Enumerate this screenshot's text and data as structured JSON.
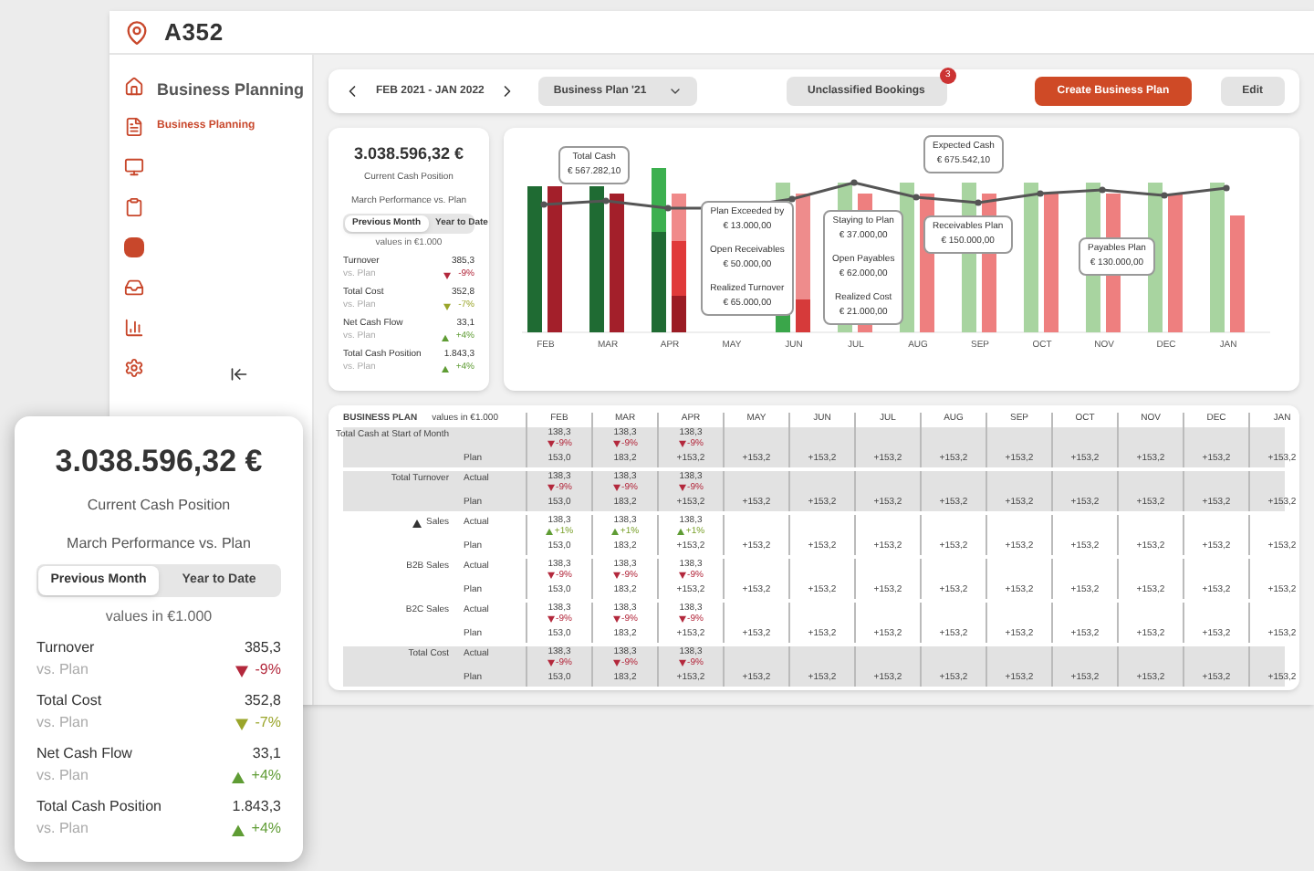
{
  "app": {
    "logo": "A352"
  },
  "sidebar": {
    "title": "Business Planning",
    "items": [
      {
        "label": "Business Planning",
        "selected": true
      }
    ]
  },
  "toolbar": {
    "period": "FEB 2021 - JAN 2022",
    "plan_select": "Business Plan '21",
    "unclassified": {
      "label": "Unclassified Bookings",
      "badge": "3"
    },
    "create": "Create Business Plan",
    "edit": "Edit"
  },
  "summary_card": {
    "amount": "3.038.596,32 €",
    "caption": "Current Cash Position",
    "subtitle": "March Performance vs. Plan",
    "toggle": [
      {
        "label": "Previous Month",
        "selected": true
      },
      {
        "label": "Year to Date",
        "selected": false
      }
    ],
    "unit": "values in €1.000",
    "metrics": [
      {
        "name": "Turnover",
        "value": "385,3",
        "sub": "vs. Plan",
        "delta": "-9%",
        "kind": "down",
        "color": "#b3283c"
      },
      {
        "name": "Total Cost",
        "value": "352,8",
        "sub": "vs. Plan",
        "delta": "-7%",
        "kind": "down",
        "color": "#9aa52a"
      },
      {
        "name": "Net Cash Flow",
        "value": "33,1",
        "sub": "vs. Plan",
        "delta": "+4%",
        "kind": "up",
        "color": "#5f9c34"
      },
      {
        "name": "Total Cash Position",
        "value": "1.843,3",
        "sub": "vs. Plan",
        "delta": "+4%",
        "kind": "up",
        "color": "#5f9c34"
      }
    ]
  },
  "chart": {
    "months": [
      "FEB",
      "MAR",
      "APR",
      "MAY",
      "JUN",
      "JUL",
      "AUG",
      "SEP",
      "OCT",
      "NOV",
      "DEC",
      "JAN"
    ],
    "callouts": [
      {
        "items": [
          {
            "label": "Total Cash",
            "amount": "€ 567.282,10"
          }
        ]
      },
      {
        "items": [
          {
            "label": "Plan Exceeded by",
            "amount": "€ 13.000,00"
          },
          {
            "label": "Open Receivables",
            "amount": "€ 50.000,00"
          },
          {
            "label": "Realized Turnover",
            "amount": "€ 65.000,00"
          }
        ]
      },
      {
        "items": [
          {
            "label": "Staying to Plan",
            "amount": "€ 37.000,00"
          },
          {
            "label": "Open Payables",
            "amount": "€ 62.000,00"
          },
          {
            "label": "Realized Cost",
            "amount": "€ 21.000,00"
          }
        ]
      },
      {
        "items": [
          {
            "label": "Expected Cash",
            "amount": "€ 675.542,10"
          }
        ]
      },
      {
        "items": [
          {
            "label": "Receivables Plan",
            "amount": "€ 150.000,00"
          }
        ]
      },
      {
        "items": [
          {
            "label": "Payables Plan",
            "amount": "€ 130.000,00"
          }
        ]
      }
    ]
  },
  "table": {
    "title": "BUSINESS PLAN",
    "unit": "values in €1.000",
    "columns": [
      "FEB",
      "MAR",
      "APR",
      "MAY",
      "JUN",
      "JUL",
      "AUG",
      "SEP",
      "OCT",
      "NOV",
      "DEC",
      "JAN"
    ],
    "groups": [
      {
        "label": "Total Cash at Start of Month",
        "shaded": true,
        "actual": [
          {
            "value": "138,3",
            "delta": "-9%",
            "kind": "down"
          },
          {
            "value": "138,3",
            "delta": "-9%",
            "kind": "down"
          },
          {
            "value": "138,3",
            "delta": "-9%",
            "kind": "down"
          }
        ],
        "plan_label": "Plan",
        "plan": [
          "153,0",
          "183,2",
          "+153,2",
          "+153,2",
          "+153,2",
          "+153,2",
          "+153,2",
          "+153,2",
          "+153,2",
          "+153,2",
          "+153,2",
          "+153,2"
        ]
      },
      {
        "label": "Total Turnover",
        "actual_label": "Actual",
        "shaded": true,
        "actual": [
          {
            "value": "138,3",
            "delta": "-9%",
            "kind": "down"
          },
          {
            "value": "138,3",
            "delta": "-9%",
            "kind": "down"
          },
          {
            "value": "138,3",
            "delta": "-9%",
            "kind": "down"
          }
        ],
        "plan_label": "Plan",
        "plan": [
          "153,0",
          "183,2",
          "+153,2",
          "+153,2",
          "+153,2",
          "+153,2",
          "+153,2",
          "+153,2",
          "+153,2",
          "+153,2",
          "+153,2",
          "+153,2"
        ]
      },
      {
        "label": "Sales",
        "expanded": true,
        "actual_label": "Actual",
        "shaded": false,
        "actual": [
          {
            "value": "138,3",
            "delta": "+1%",
            "kind": "up"
          },
          {
            "value": "138,3",
            "delta": "+1%",
            "kind": "up"
          },
          {
            "value": "138,3",
            "delta": "+1%",
            "kind": "up"
          }
        ],
        "plan_label": "Plan",
        "plan": [
          "153,0",
          "183,2",
          "+153,2",
          "+153,2",
          "+153,2",
          "+153,2",
          "+153,2",
          "+153,2",
          "+153,2",
          "+153,2",
          "+153,2",
          "+153,2"
        ]
      },
      {
        "label": "B2B Sales",
        "actual_label": "Actual",
        "shaded": false,
        "actual": [
          {
            "value": "138,3",
            "delta": "-9%",
            "kind": "down"
          },
          {
            "value": "138,3",
            "delta": "-9%",
            "kind": "down"
          },
          {
            "value": "138,3",
            "delta": "-9%",
            "kind": "down"
          }
        ],
        "plan_label": "Plan",
        "plan": [
          "153,0",
          "183,2",
          "+153,2",
          "+153,2",
          "+153,2",
          "+153,2",
          "+153,2",
          "+153,2",
          "+153,2",
          "+153,2",
          "+153,2",
          "+153,2"
        ]
      },
      {
        "label": "B2C Sales",
        "actual_label": "Actual",
        "shaded": false,
        "actual": [
          {
            "value": "138,3",
            "delta": "-9%",
            "kind": "down"
          },
          {
            "value": "138,3",
            "delta": "-9%",
            "kind": "down"
          },
          {
            "value": "138,3",
            "delta": "-9%",
            "kind": "down"
          }
        ],
        "plan_label": "Plan",
        "plan": [
          "153,0",
          "183,2",
          "+153,2",
          "+153,2",
          "+153,2",
          "+153,2",
          "+153,2",
          "+153,2",
          "+153,2",
          "+153,2",
          "+153,2",
          "+153,2"
        ]
      },
      {
        "label": "Total Cost",
        "actual_label": "Actual",
        "shaded": true,
        "actual": [
          {
            "value": "138,3",
            "delta": "-9%",
            "kind": "down"
          },
          {
            "value": "138,3",
            "delta": "-9%",
            "kind": "down"
          },
          {
            "value": "138,3",
            "delta": "-9%",
            "kind": "down"
          }
        ],
        "plan_label": "Plan",
        "plan": [
          "153,0",
          "183,2",
          "+153,2",
          "+153,2",
          "+153,2",
          "+153,2",
          "+153,2",
          "+153,2",
          "+153,2",
          "+153,2",
          "+153,2",
          "+153,2"
        ]
      }
    ]
  },
  "popup_card": {
    "amount": "3.038.596,32 €",
    "caption": "Current Cash Position",
    "subtitle": "March Performance vs. Plan",
    "toggle": [
      {
        "label": "Previous Month",
        "selected": true
      },
      {
        "label": "Year to Date",
        "selected": false
      }
    ],
    "unit": "values in €1.000",
    "metrics": [
      {
        "name": "Turnover",
        "value": "385,3",
        "sub": "vs. Plan",
        "delta": "-9%",
        "kind": "down",
        "color": "#b3283c"
      },
      {
        "name": "Total Cost",
        "value": "352,8",
        "sub": "vs. Plan",
        "delta": "-7%",
        "kind": "down",
        "color": "#9aa52a"
      },
      {
        "name": "Net Cash Flow",
        "value": "33,1",
        "sub": "vs. Plan",
        "delta": "+4%",
        "kind": "up",
        "color": "#5f9c34"
      },
      {
        "name": "Total Cash Position",
        "value": "1.843,3",
        "sub": "vs. Plan",
        "delta": "+4%",
        "kind": "up",
        "color": "#5f9c34"
      }
    ]
  }
}
